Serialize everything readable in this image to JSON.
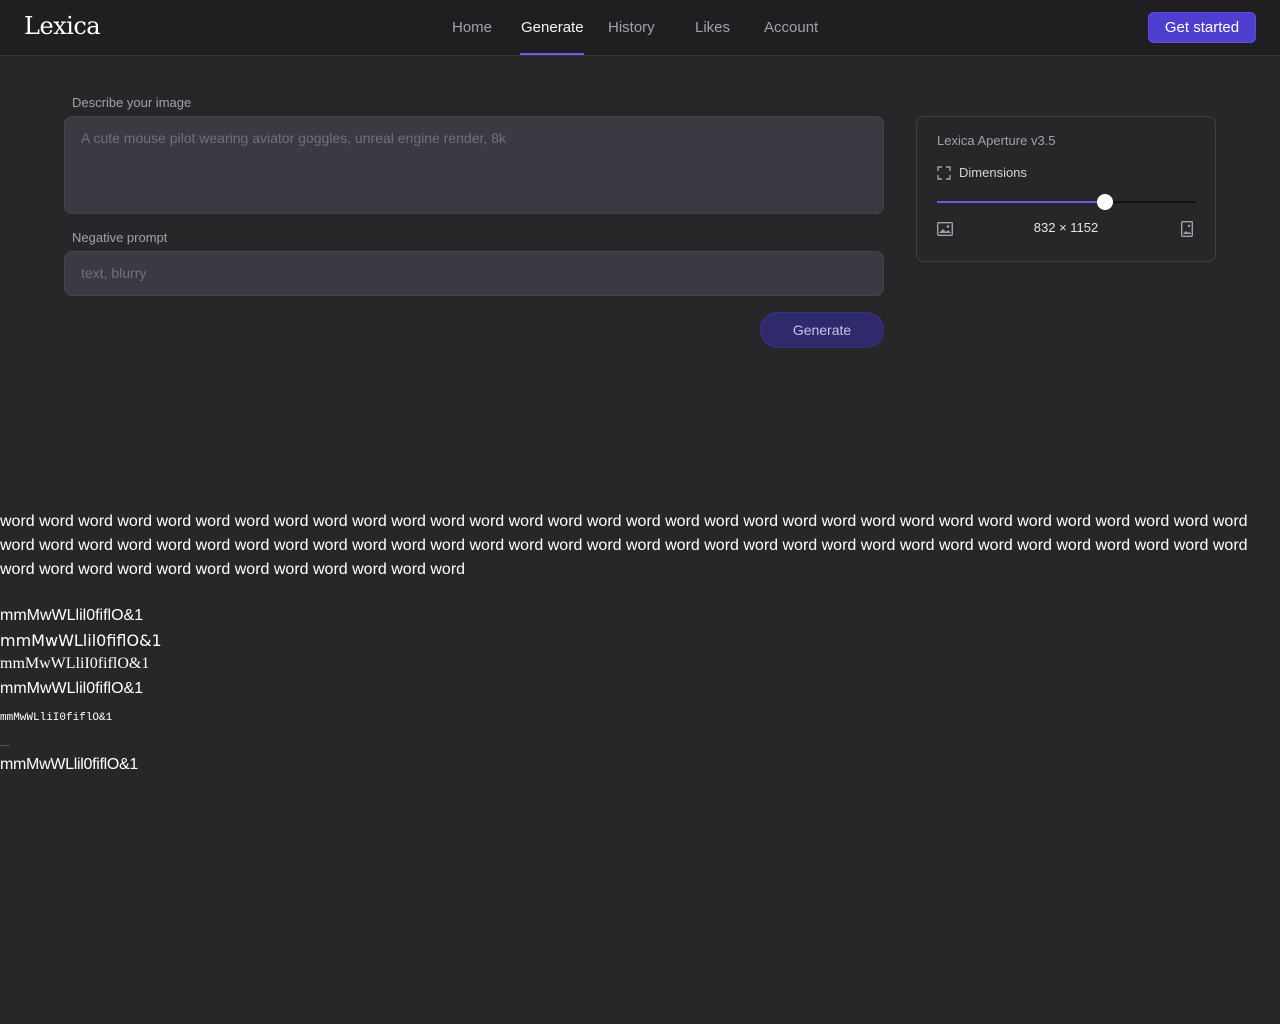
{
  "header": {
    "logo": "Lexica",
    "nav": [
      {
        "label": "Home"
      },
      {
        "label": "Generate"
      },
      {
        "label": "History"
      },
      {
        "label": "Likes"
      },
      {
        "label": "Account"
      }
    ],
    "active_nav": "Generate",
    "cta_label": "Get started"
  },
  "form": {
    "describe_label": "Describe your image",
    "describe_placeholder": "A cute mouse pilot wearing aviator goggles, unreal engine render, 8k",
    "negative_label": "Negative prompt",
    "negative_placeholder": "text, blurry",
    "generate_label": "Generate"
  },
  "panel": {
    "model": "Lexica Aperture v3.5",
    "dimensions_label": "Dimensions",
    "dimensions_value": "832 × 1152",
    "slider_fraction": 0.65
  },
  "debug": {
    "word_lines": [
      "word word word word word word word word word word word word word word word word word word word word word word word word word word word word word word word word",
      "word word word word word word word word word word word word word word word word word word word word word word word word word word word word word word word word",
      "word word word word word word word word word word word word"
    ],
    "font_samples": [
      "mmMwWLlil0fiflO&1",
      "mmMwWLlil0fiflO&1",
      "mmMwWLliI0fiflO&1",
      "mmMwWLlil0fiflO&1",
      "mmMwWLliI0fiflO&1",
      "mmMwWLlil0fiflO&1"
    ]
  },
  "colors": {
    "accent": "#6d5ce8",
    "cta": "#4f3fd1",
    "background": "#27272a"
  }
}
